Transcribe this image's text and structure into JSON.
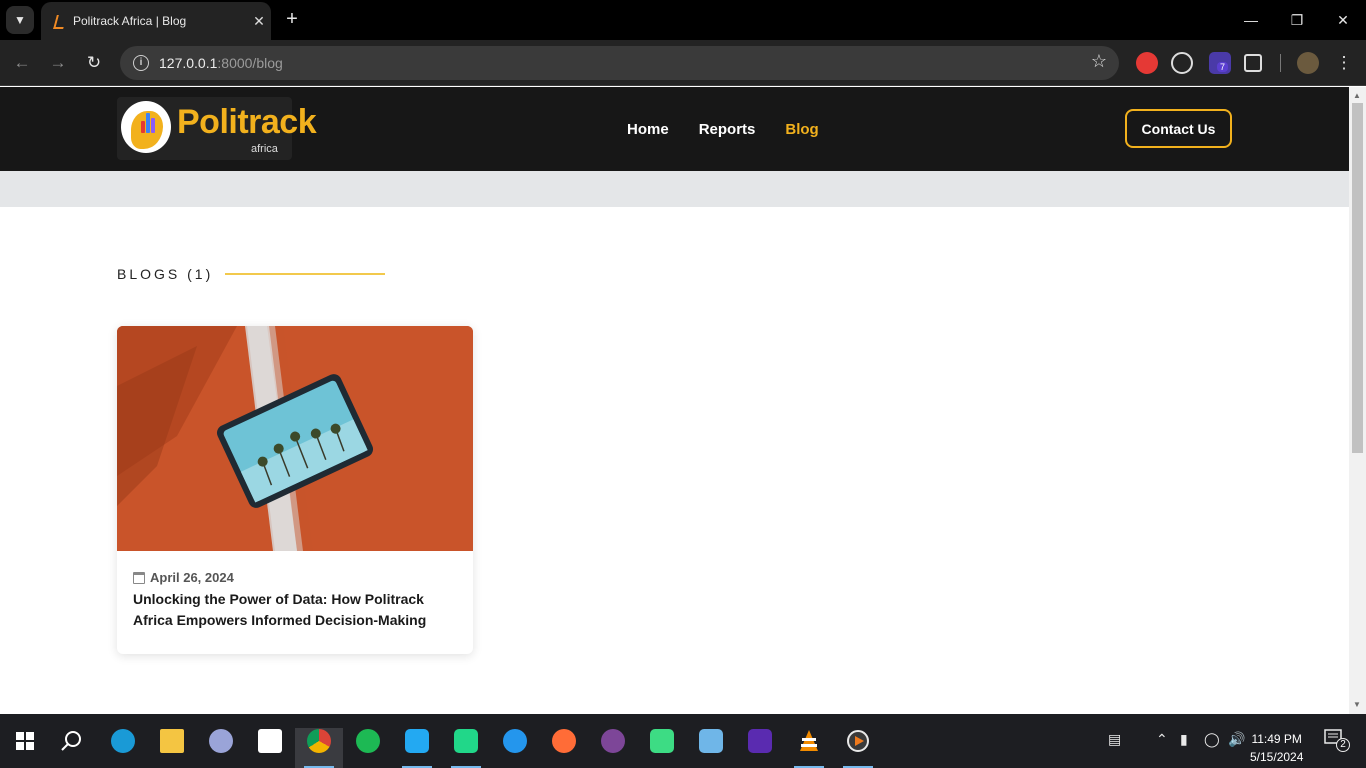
{
  "browser": {
    "tab_title": "Politrack Africa | Blog",
    "url_host": "127.0.0.1",
    "url_rest": ":8000/blog",
    "extension_badge": "7"
  },
  "site": {
    "logo_text": "Politrack",
    "logo_sub": "africa",
    "nav": [
      {
        "label": "Home"
      },
      {
        "label": "Reports"
      },
      {
        "label": "Blog"
      }
    ],
    "contact_label": "Contact Us"
  },
  "content": {
    "section_title": "BLOGS (1)",
    "posts": [
      {
        "date": "April 26, 2024",
        "title": "Unlocking the Power of Data: How Politrack Africa Empowers Informed Decision-Making"
      }
    ]
  },
  "taskbar": {
    "time": "11:49 PM",
    "date": "5/15/2024",
    "notification_count": "2"
  },
  "colors": {
    "accent": "#f2b11d",
    "header_bg": "#171717"
  }
}
